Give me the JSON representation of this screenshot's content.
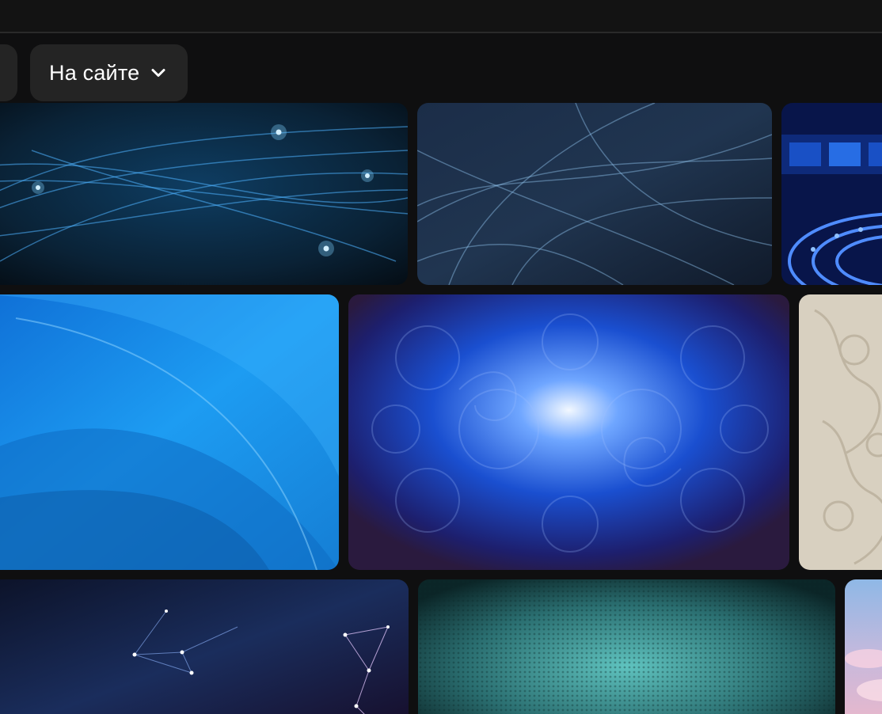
{
  "filters": {
    "site_chip_label": "На сайте",
    "site_chip_icon": "chevron-down-icon"
  },
  "results": {
    "tiles": [
      {
        "name": "blue-light-streaks",
        "colors": [
          "#0a2a44",
          "#1e6fae",
          "#7fd0ff"
        ]
      },
      {
        "name": "blue-fractal-waves",
        "colors": [
          "#162238",
          "#2d5a8a",
          "#8ec2ea"
        ]
      },
      {
        "name": "blue-stage-rings",
        "colors": [
          "#081a5a",
          "#1f4fd6",
          "#6fb0ff"
        ]
      },
      {
        "name": "bright-blue-curves",
        "colors": [
          "#0d6fd0",
          "#1ea3f7",
          "#55c3ff"
        ]
      },
      {
        "name": "blue-paisley-pattern",
        "colors": [
          "#1a1a4a",
          "#1849c9",
          "#e8f2ff"
        ]
      },
      {
        "name": "beige-damask",
        "colors": [
          "#cfc6b4",
          "#e6ddcc"
        ]
      },
      {
        "name": "plexus-network",
        "colors": [
          "#0f1630",
          "#25477a",
          "#ffffff"
        ]
      },
      {
        "name": "teal-mosaic",
        "colors": [
          "#0c2e30",
          "#2c7e7d",
          "#7ad1cc"
        ]
      },
      {
        "name": "pink-sky",
        "colors": [
          "#9ec4e8",
          "#e8b0c4"
        ]
      }
    ]
  }
}
